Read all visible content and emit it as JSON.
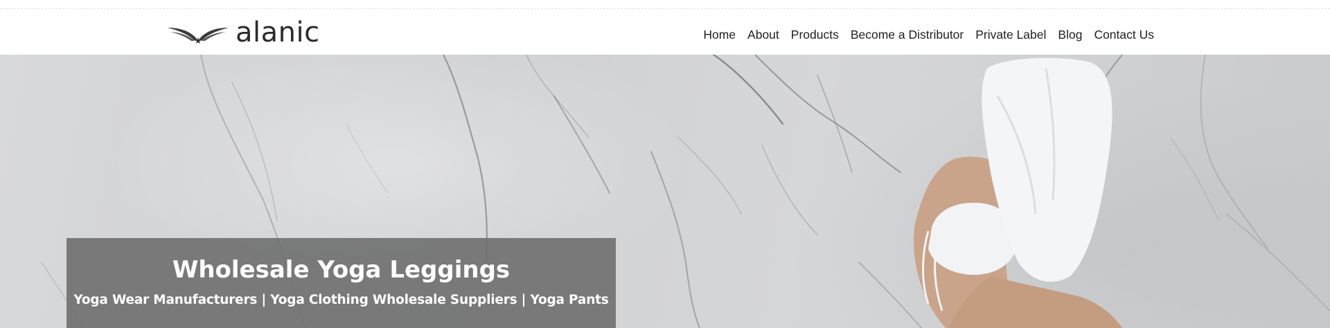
{
  "brand": {
    "logo_text": "alanic",
    "logo_icon": "wings-icon"
  },
  "nav": {
    "items": [
      {
        "label": "Home"
      },
      {
        "label": "About"
      },
      {
        "label": "Products"
      },
      {
        "label": "Become a Distributor"
      },
      {
        "label": "Private Label"
      },
      {
        "label": "Blog"
      },
      {
        "label": "Contact Us"
      }
    ]
  },
  "hero": {
    "title": "Wholesale Yoga Leggings",
    "subtitle": "Yoga Wear Manufacturers | Yoga Clothing Wholesale Suppliers | Yoga Pants"
  },
  "colors": {
    "header_bg": "#ffffff",
    "nav_text": "#1f1f1f",
    "hero_marble": "#d3d4d6",
    "caption_bg": "#6c6c6c",
    "caption_text": "#ffffff"
  }
}
